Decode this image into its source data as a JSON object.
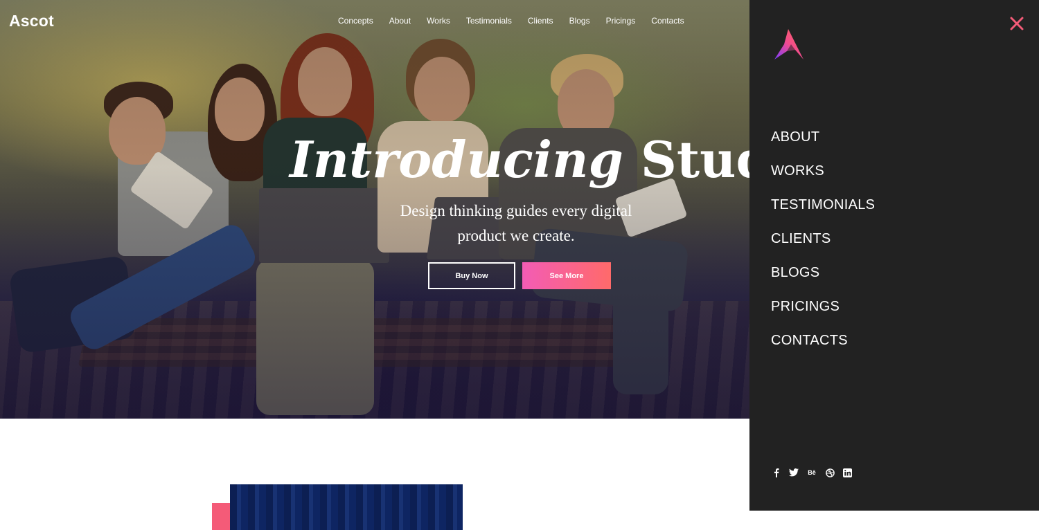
{
  "header": {
    "logo": "Ascot",
    "nav": [
      "Concepts",
      "About",
      "Works",
      "Testimonials",
      "Clients",
      "Blogs",
      "Pricings",
      "Contacts"
    ]
  },
  "hero": {
    "headline_italic": "Introducing",
    "headline_bold": "Studio",
    "subheadline_line1": "Design thinking guides every digital",
    "subheadline_line2": "product we create.",
    "primary_button": "Buy Now",
    "secondary_button": "See More"
  },
  "side_menu": {
    "items": [
      "ABOUT",
      "WORKS",
      "TESTIMONIALS",
      "CLIENTS",
      "BLOGS",
      "PRICINGS",
      "CONTACTS"
    ],
    "social_icons": [
      "facebook-icon",
      "twitter-icon",
      "behance-icon",
      "dribbble-icon",
      "linkedin-icon"
    ]
  },
  "colors": {
    "panel_bg": "#222222",
    "accent_pink": "#f35cb5",
    "accent_coral": "#ff6a6a",
    "close_icon": "#f45b78",
    "dark_blue": "#0c1f53"
  }
}
